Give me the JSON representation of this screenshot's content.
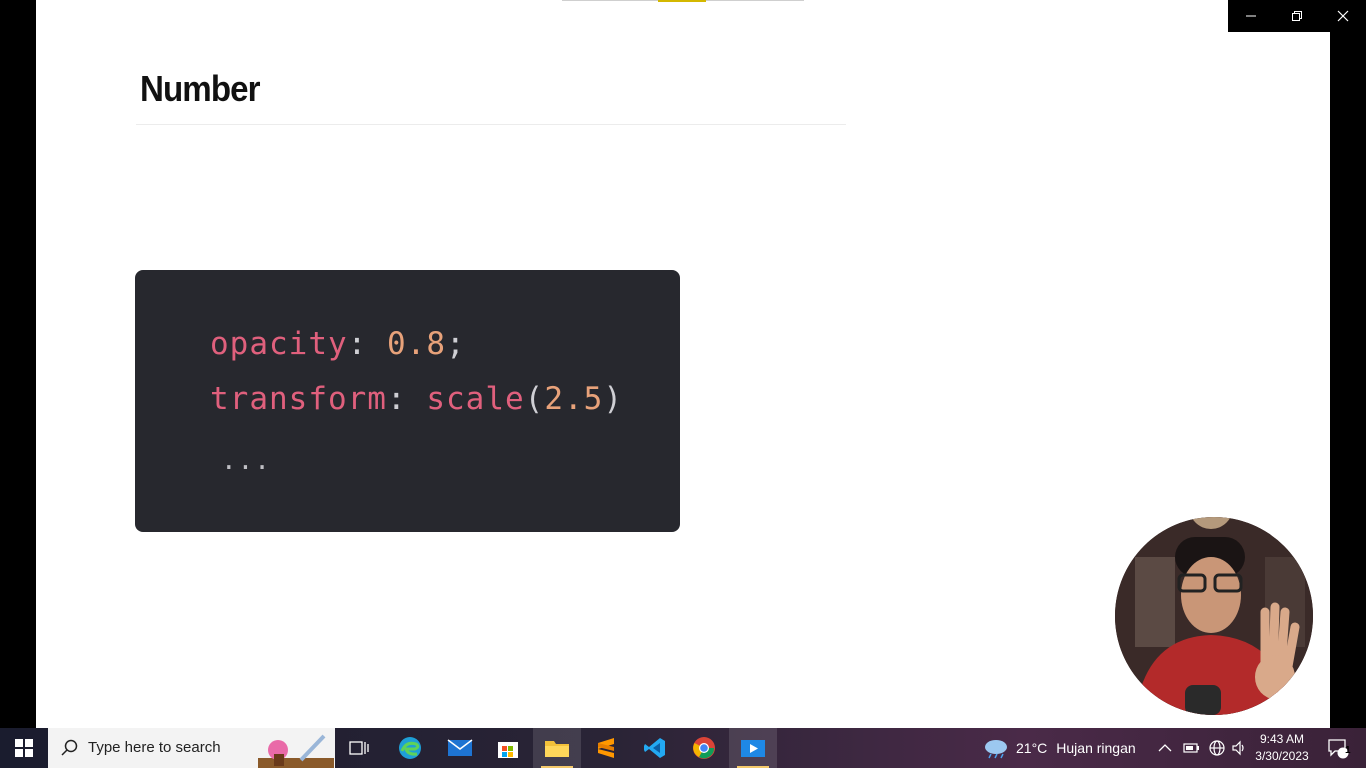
{
  "slide": {
    "heading": "Number",
    "code": {
      "line1": {
        "prop": "opacity",
        "colon": ":",
        "value": "0.8",
        "semi": ";"
      },
      "line2": {
        "prop": "transform",
        "colon": ":",
        "fn": "scale",
        "open": "(",
        "value": "2.5",
        "close": ")"
      },
      "line3": "..."
    }
  },
  "window_controls": {
    "minimize_icon": "minimize-icon",
    "restore_icon": "restore-icon",
    "close_icon": "close-icon"
  },
  "taskbar": {
    "search_placeholder": "Type here to search",
    "apps": [
      "task-view",
      "edge",
      "mail",
      "microsoft-store",
      "file-explorer",
      "sublime-text",
      "vscode",
      "chrome",
      "video-player"
    ],
    "weather": {
      "temp": "21°C",
      "desc": "Hujan ringan"
    },
    "clock": {
      "time": "9:43 AM",
      "date": "3/30/2023"
    },
    "notifications_count": "1"
  },
  "colors": {
    "code_bg": "#27282e",
    "prop": "#e0607d",
    "number": "#e8a27a",
    "accent_underline": "#f4c96b"
  }
}
